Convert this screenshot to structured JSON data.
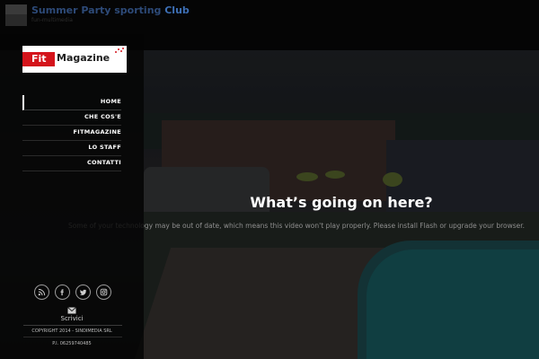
{
  "header": {
    "site_title_a": "Summer Party sporting ",
    "site_title_b": "Club",
    "site_subtitle": "fun-multimedia"
  },
  "sidebar": {
    "logo": {
      "fit": "Fit",
      "magazine": "Magazine"
    },
    "nav": [
      {
        "label": "HOME",
        "active": true
      },
      {
        "label": "CHE COS'E",
        "active": false
      },
      {
        "label": "FITMAGAZINE",
        "active": false
      },
      {
        "label": "LO STAFF",
        "active": false
      },
      {
        "label": "CONTATTI",
        "active": false
      }
    ],
    "socials": [
      "rss-icon",
      "facebook-icon",
      "twitter-icon",
      "instagram-icon"
    ],
    "contact_label": "Scrivici",
    "copyright": "COPYRIGHT 2014 - SINDIMEDIA SRL",
    "vat": "P.I. 06259740485"
  },
  "video": {
    "heading": "What’s going on here?",
    "message": "Some of your technology may be out of date, which means this video won't play properly. Please install Flash or upgrade your browser."
  },
  "colors": {
    "brand_red": "#d4141b",
    "title_blue": "#3d6fb5",
    "background": "#000000"
  }
}
